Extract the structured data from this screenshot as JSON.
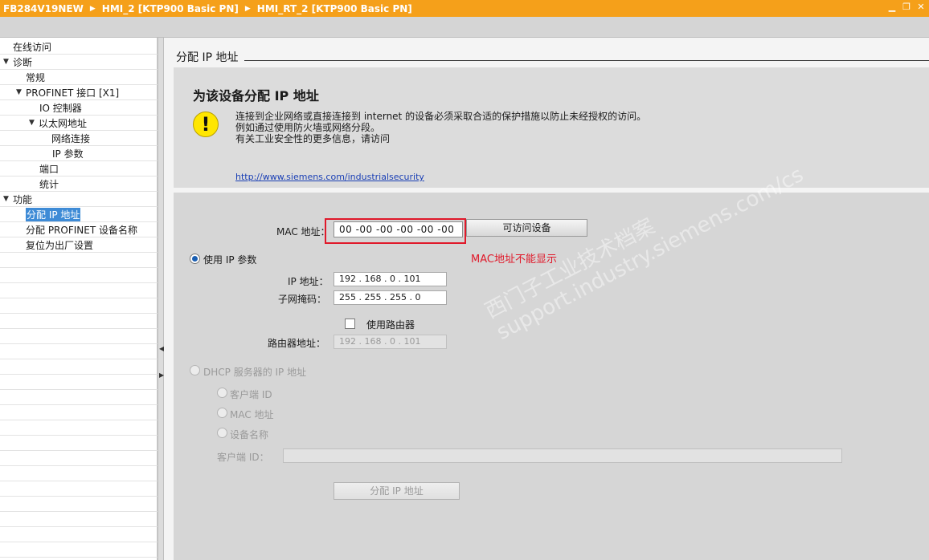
{
  "titlebar": {
    "crumbs": [
      "FB284V19NEW",
      "HMI_2 [KTP900 Basic PN]",
      "HMI_RT_2 [KTP900 Basic PN]"
    ],
    "separator": "▶",
    "minimize": "▁",
    "restore": "❐",
    "close": "✕"
  },
  "nav": {
    "items": [
      {
        "label": "在线访问",
        "expander": ""
      },
      {
        "label": "诊断",
        "expander": "▼"
      },
      {
        "label": "常规",
        "expander": ""
      },
      {
        "label": "PROFINET 接口 [X1]",
        "expander": "▼"
      },
      {
        "label": "IO 控制器",
        "expander": ""
      },
      {
        "label": "以太网地址",
        "expander": "▼"
      },
      {
        "label": "网络连接",
        "expander": ""
      },
      {
        "label": "IP 参数",
        "expander": ""
      },
      {
        "label": "端口",
        "expander": ""
      },
      {
        "label": "统计",
        "expander": ""
      },
      {
        "label": "功能",
        "expander": "▼"
      },
      {
        "label": "分配 IP 地址",
        "expander": ""
      },
      {
        "label": "分配 PROFINET 设备名称",
        "expander": ""
      },
      {
        "label": "复位为出厂设置",
        "expander": ""
      }
    ],
    "selected_index": 11
  },
  "splitter": {
    "collapse_left": "◀",
    "expand_right": "▶"
  },
  "main": {
    "section_title": "分配 IP 地址",
    "warning": {
      "heading": "为该设备分配 IP 地址",
      "icon": "warning-icon",
      "icon_glyph": "!",
      "line1": "连接到企业网络或直接连接到 internet 的设备必须采取合适的保护措施以防止未经授权的访问。",
      "line2": "例如通过使用防火墙或网络分段。",
      "line3": "有关工业安全性的更多信息，请访问",
      "link": "http://www.siemens.com/industrialsecurity"
    },
    "form": {
      "mac_label": "MAC 地址：",
      "mac_value": "00 -00 -00 -00 -00 -00",
      "accessible_devices_button": "可访问设备",
      "annotation": "MAC地址不能显示",
      "use_ip_params_label": "使用 IP 参数",
      "ip_label": "IP 地址：",
      "ip_value": "192 . 168 . 0    . 101",
      "subnet_label": "子网掩码：",
      "subnet_value": "255 . 255 . 255 . 0",
      "use_router_label": "使用路由器",
      "router_label": "路由器地址：",
      "router_value": "192 . 168 . 0    . 101",
      "dhcp_label": "DHCP 服务器的 IP 地址",
      "client_id_option": "客户端 ID",
      "mac_option": "MAC 地址",
      "device_name_option": "设备名称",
      "client_id_label": "客户端 ID：",
      "client_id_value": "",
      "assign_button": "分配 IP 地址",
      "use_ip_params_checked": true,
      "use_router_checked": false
    },
    "watermark": {
      "line1": "西门子工业技术档案",
      "line2": "support.industry.siemens.com/cs"
    }
  },
  "colors": {
    "titlebar": "#f5a01a",
    "selection": "#3e8bd6",
    "highlight": "#e0192a",
    "link": "#1a3fb5",
    "warning_icon": "#ffe600"
  }
}
